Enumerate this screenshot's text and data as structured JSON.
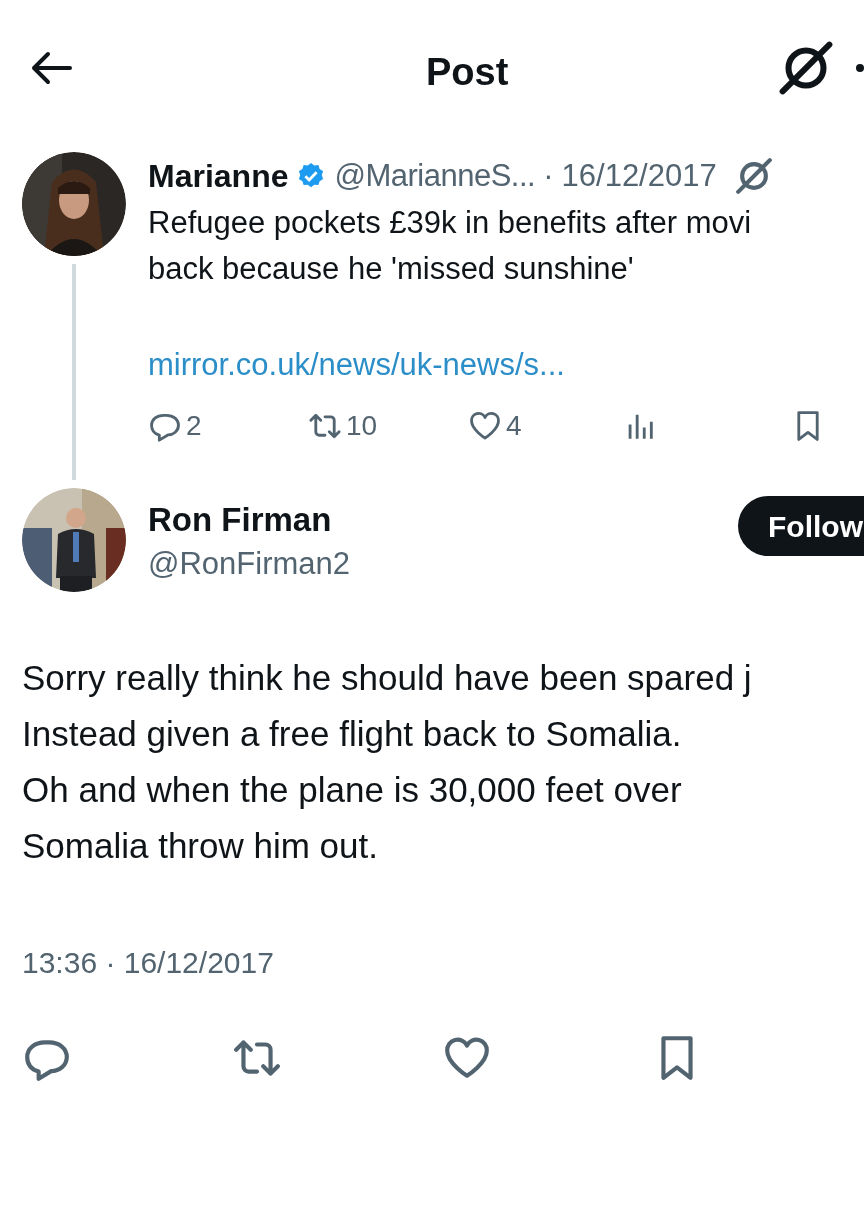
{
  "header": {
    "title": "Post"
  },
  "quoted_post": {
    "name": "Marianne",
    "verified": true,
    "handle": "@MarianneS...",
    "separator": "·",
    "date": "16/12/2017",
    "text_lines": [
      "Refugee pockets £39k in benefits after movi",
      "back because he 'missed sunshine'"
    ],
    "link": "mirror.co.uk/news/uk-news/s...",
    "actions": [
      {
        "kind": "reply",
        "count": "2"
      },
      {
        "kind": "repost",
        "count": "10"
      },
      {
        "kind": "like",
        "count": "4"
      },
      {
        "kind": "views"
      },
      {
        "kind": "bookmark"
      }
    ]
  },
  "post": {
    "name": "Ron Firman",
    "handle": "@RonFirman2",
    "follow_button": "Follow",
    "text_lines": [
      "Sorry really think he should have been spared j",
      "Instead given a free flight back to Somalia.",
      "Oh and when the plane is 30,000 feet over",
      "Somalia throw him out."
    ],
    "timestamp": "13:36 · 16/12/2017",
    "actions": [
      {
        "kind": "reply"
      },
      {
        "kind": "repost"
      },
      {
        "kind": "like"
      },
      {
        "kind": "bookmark"
      }
    ]
  }
}
